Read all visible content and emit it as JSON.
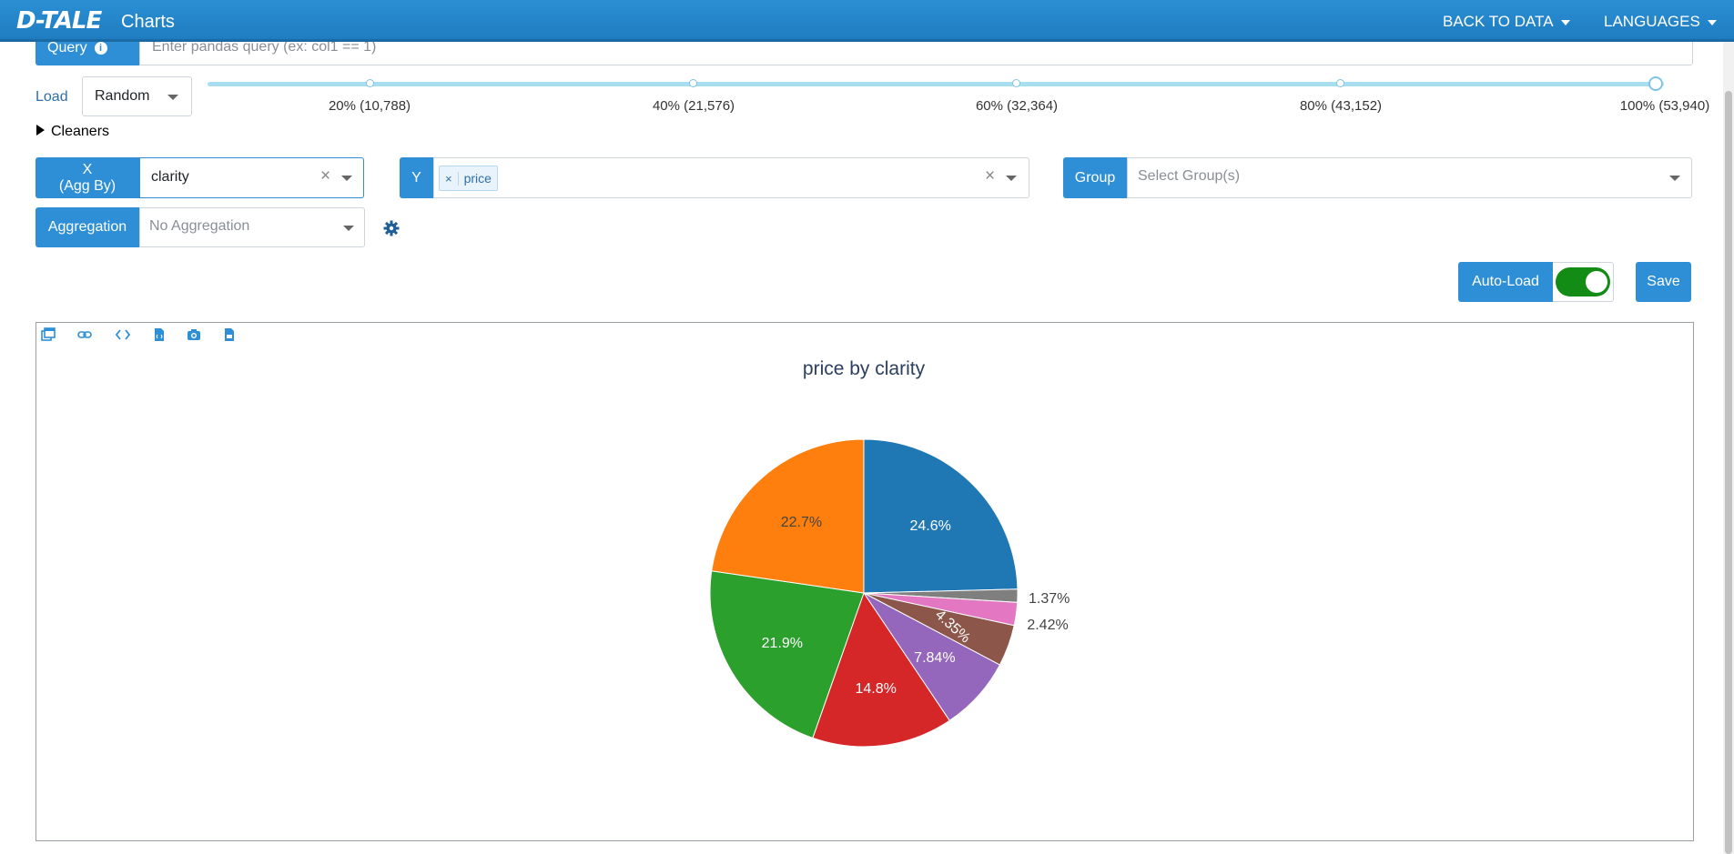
{
  "header": {
    "logo_text": "D-TALE",
    "title": "Charts",
    "nav_back": "BACK TO DATA",
    "nav_languages": "LANGUAGES"
  },
  "query": {
    "label": "Query",
    "info_icon": "info-circle-icon",
    "placeholder": "Enter pandas query (ex: col1 == 1)"
  },
  "load": {
    "label": "Load",
    "selected": "Random",
    "slider_marks": [
      "20% (10,788)",
      "40% (21,576)",
      "60% (32,364)",
      "80% (43,152)",
      "100% (53,940)"
    ],
    "slider_value_percent": 100
  },
  "cleaners": {
    "label": "Cleaners"
  },
  "x_field": {
    "label_line1": "X",
    "label_line2": "(Agg By)",
    "value": "clarity"
  },
  "y_field": {
    "label": "Y",
    "tag": "price",
    "tag_remove": "×"
  },
  "group_field": {
    "label": "Group",
    "placeholder": "Select Group(s)"
  },
  "aggregation": {
    "label": "Aggregation",
    "placeholder": "No Aggregation",
    "settings_icon": "gear-icon"
  },
  "autoload": {
    "label": "Auto-Load",
    "on": true
  },
  "save_label": "Save",
  "toolbar_icons": [
    "popup-icon",
    "link-icon",
    "code-icon",
    "export-html-icon",
    "camera-icon",
    "export-csv-icon"
  ],
  "chart_data": {
    "type": "pie",
    "title": "price by clarity",
    "slices": [
      {
        "label": "24.6%",
        "value": 24.6,
        "color": "#1f77b4"
      },
      {
        "label": "1.37%",
        "value": 1.37,
        "color": "#7f7f7f"
      },
      {
        "label": "2.42%",
        "value": 2.42,
        "color": "#e377c2"
      },
      {
        "label": "4.35%",
        "value": 4.35,
        "color": "#8c564b"
      },
      {
        "label": "7.84%",
        "value": 7.84,
        "color": "#9467bd"
      },
      {
        "label": "14.8%",
        "value": 14.8,
        "color": "#d62728"
      },
      {
        "label": "21.9%",
        "value": 21.9,
        "color": "#2ca02c"
      },
      {
        "label": "22.7%",
        "value": 22.7,
        "color": "#ff7f0e"
      }
    ]
  }
}
